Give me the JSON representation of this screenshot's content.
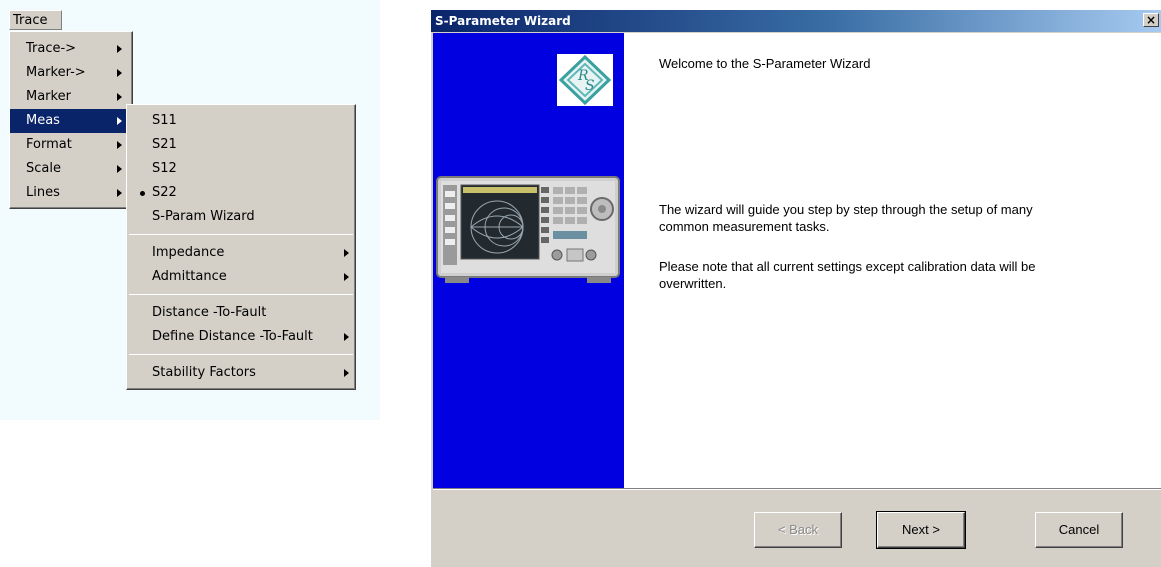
{
  "menu": {
    "title": "Trace",
    "items": [
      {
        "label": "Trace->",
        "has_submenu": true
      },
      {
        "label": "Marker->",
        "has_submenu": true
      },
      {
        "label": "Marker",
        "has_submenu": true
      },
      {
        "label": "Meas",
        "has_submenu": true,
        "selected": true
      },
      {
        "label": "Format",
        "has_submenu": true
      },
      {
        "label": "Scale",
        "has_submenu": true
      },
      {
        "label": "Lines",
        "has_submenu": true
      }
    ],
    "submenu": {
      "items": [
        {
          "label": "S11"
        },
        {
          "label": "S21"
        },
        {
          "label": "S12"
        },
        {
          "label": "S22",
          "checked": true
        },
        {
          "label": "S-Param Wizard"
        },
        {
          "label": "Impedance",
          "has_submenu": true
        },
        {
          "label": "Admittance",
          "has_submenu": true
        },
        {
          "label": "Distance -To-Fault"
        },
        {
          "label": "Define Distance -To-Fault",
          "has_submenu": true
        },
        {
          "label": "Stability Factors",
          "has_submenu": true
        }
      ]
    }
  },
  "wizard": {
    "title": "S-Parameter Wizard",
    "close_label": "×",
    "welcome": "Welcome to the S-Parameter Wizard",
    "paragraph1": "The wizard will guide you step by step through the setup of many common measurement tasks.",
    "paragraph2": "Please note that all current settings except calibration data will be overwritten.",
    "buttons": {
      "back": "< Back",
      "next": "Next >",
      "cancel": "Cancel"
    },
    "colors": {
      "side_panel": "#0000e0",
      "titlebar": "#0a246a"
    }
  }
}
